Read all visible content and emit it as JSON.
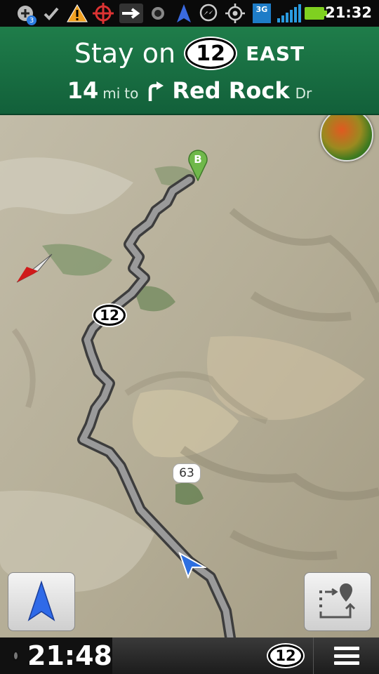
{
  "status_bar": {
    "time": "21:32",
    "notification_count": "3",
    "network_label": "3G",
    "icons": [
      "add-circle-icon",
      "checkmark-icon",
      "warning-icon",
      "crosshair-icon",
      "arrow-right-icon",
      "record-icon",
      "navigation-arrow-icon",
      "messenger-icon",
      "gps-icon",
      "3g-icon",
      "signal-bars-icon",
      "battery-icon"
    ]
  },
  "direction": {
    "action": "Stay on",
    "route_number": "12",
    "route_direction": "EAST",
    "distance": "14",
    "distance_unit": "mi",
    "to_text": "to",
    "turn_icon": "turn-right-icon",
    "street_name": "Red Rock",
    "street_suffix": "Dr"
  },
  "map": {
    "route_shield": "12",
    "side_road_shield": "63",
    "destination_marker": "B",
    "colors": {
      "route": "#8f8f8f",
      "marker": "#6fb84a",
      "banner": "#17704a",
      "position_arrow": "#2d6fe0"
    }
  },
  "bottom_bar": {
    "clock": "21:48",
    "route_shield": "12"
  }
}
